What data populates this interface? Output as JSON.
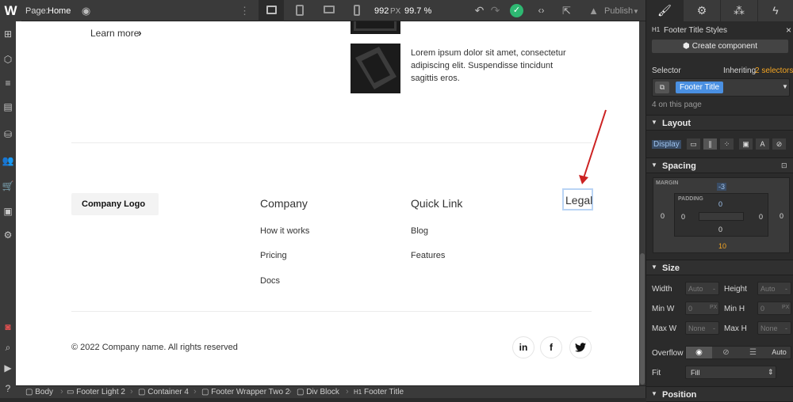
{
  "topbar": {
    "logo": "W",
    "page_prefix": "Page:",
    "page_name": "Home",
    "width_value": "992",
    "width_unit": "PX",
    "zoom": "99.7 %",
    "publish_label": "Publish"
  },
  "canvas": {
    "learn_more": "Learn more",
    "learn_more_chevron": "›",
    "blog_text": "Lorem ipsum dolor sit amet, consectetur adipiscing elit. Suspendisse tincidunt sagittis eros.",
    "company_logo": "Company Logo",
    "columns": [
      {
        "title": "Company",
        "links": [
          "How it works",
          "Pricing",
          "Docs"
        ]
      },
      {
        "title": "Quick Link",
        "links": [
          "Blog",
          "Features"
        ]
      },
      {
        "title": "Legal",
        "links": []
      }
    ],
    "copyright": "© 2022 Company name. All rights reserved",
    "social": [
      {
        "icon": "linkedin-icon",
        "glyph": "in"
      },
      {
        "icon": "facebook-icon",
        "glyph": "f"
      },
      {
        "icon": "twitter-icon",
        "glyph": "🐦"
      }
    ],
    "annotation_color": "#cc2222"
  },
  "breadcrumb": {
    "items": [
      {
        "icon": "box-icon",
        "label": "Body"
      },
      {
        "icon": "section-icon",
        "label": "Footer Light 2"
      },
      {
        "icon": "box-icon",
        "label": "Container 4"
      },
      {
        "icon": "box-icon",
        "label": "Footer Wrapper Two 2"
      },
      {
        "icon": "box-icon",
        "label": "Div Block"
      },
      {
        "icon": "heading-icon",
        "label": "Footer Title"
      }
    ]
  },
  "panel": {
    "tabs": [
      "style-icon",
      "settings-icon",
      "interactions-icon",
      "lightning-icon"
    ],
    "element_tag": "H1",
    "element_styles": "Footer Title Styles",
    "create_component": "Create component",
    "selector_label": "Selector",
    "inheriting_prefix": "Inheriting",
    "inheriting_link": "2 selectors",
    "selector_chip": "Footer Title",
    "on_page": "4 on this page",
    "sections": {
      "layout": "Layout",
      "spacing": "Spacing",
      "size": "Size",
      "position": "Position"
    },
    "display_label": "Display",
    "spacing": {
      "margin_label": "MARGIN",
      "padding_label": "PADDING",
      "margin_top": "-3",
      "margin_left": "0",
      "margin_right": "0",
      "margin_bottom": "10",
      "padding_top": "0",
      "padding_left": "0",
      "padding_right": "0",
      "padding_bottom": "0"
    },
    "size": {
      "width_label": "Width",
      "height_label": "Height",
      "minw_label": "Min W",
      "minh_label": "Min H",
      "maxw_label": "Max W",
      "maxh_label": "Max H",
      "auto": "Auto",
      "zero": "0",
      "none": "None",
      "px": "PX",
      "dash": "-"
    },
    "overflow_label": "Overflow",
    "overflow_auto": "Auto",
    "fit_label": "Fit",
    "fit_value": "Fill",
    "accent_color": "#4a90e2",
    "warn_color": "#f5a623"
  }
}
